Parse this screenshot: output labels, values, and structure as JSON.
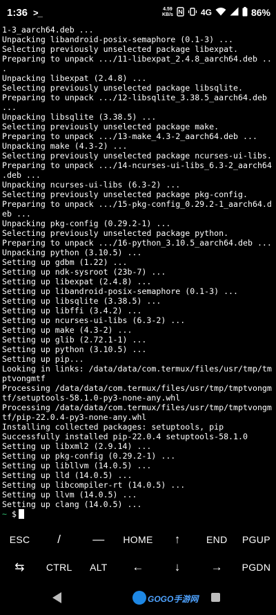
{
  "status_bar": {
    "time": "1:36",
    "app_glyph": ">_",
    "net_speed_value": "4.59",
    "net_speed_unit": "KB/s",
    "network_type": "4G",
    "battery": "86%"
  },
  "terminal": {
    "lines": [
      "1-3_aarch64.deb ...",
      "Unpacking libandroid-posix-semaphore (0.1-3) ...",
      "Selecting previously unselected package libexpat.",
      "Preparing to unpack .../11-libexpat_2.4.8_aarch64.deb ..",
      ".",
      "Unpacking libexpat (2.4.8) ...",
      "Selecting previously unselected package libsqlite.",
      "Preparing to unpack .../12-libsqlite_3.38.5_aarch64.deb",
      "...",
      "Unpacking libsqlite (3.38.5) ...",
      "Selecting previously unselected package make.",
      "Preparing to unpack .../13-make_4.3-2_aarch64.deb ...",
      "Unpacking make (4.3-2) ...",
      "Selecting previously unselected package ncurses-ui-libs.",
      "Preparing to unpack .../14-ncurses-ui-libs_6.3-2_aarch64",
      ".deb ...",
      "Unpacking ncurses-ui-libs (6.3-2) ...",
      "Selecting previously unselected package pkg-config.",
      "Preparing to unpack .../15-pkg-config_0.29.2-1_aarch64.d",
      "eb ...",
      "Unpacking pkg-config (0.29.2-1) ...",
      "Selecting previously unselected package python.",
      "Preparing to unpack .../16-python_3.10.5_aarch64.deb ...",
      "Unpacking python (3.10.5) ...",
      "Setting up gdbm (1.22) ...",
      "Setting up ndk-sysroot (23b-7) ...",
      "Setting up libexpat (2.4.8) ...",
      "Setting up libandroid-posix-semaphore (0.1-3) ...",
      "Setting up libsqlite (3.38.5) ...",
      "Setting up libffi (3.4.2) ...",
      "Setting up ncurses-ui-libs (6.3-2) ...",
      "Setting up make (4.3-2) ...",
      "Setting up glib (2.72.1-1) ...",
      "Setting up python (3.10.5) ...",
      "Setting up pip...",
      "Looking in links: /data/data/com.termux/files/usr/tmp/tm",
      "ptvongmtf",
      "Processing /data/data/com.termux/files/usr/tmp/tmptvongm",
      "tf/setuptools-58.1.0-py3-none-any.whl",
      "Processing /data/data/com.termux/files/usr/tmp/tmptvongm",
      "tf/pip-22.0.4-py3-none-any.whl",
      "Installing collected packages: setuptools, pip",
      "Successfully installed pip-22.0.4 setuptools-58.1.0",
      "Setting up libxml2 (2.9.14) ...",
      "Setting up pkg-config (0.29.2-1) ...",
      "Setting up libllvm (14.0.5) ...",
      "Setting up lld (14.0.5) ...",
      "Setting up libcompiler-rt (14.0.5) ...",
      "Setting up llvm (14.0.5) ...",
      "Setting up clang (14.0.5) ..."
    ],
    "prompt_tilde": "~",
    "prompt_sign": " $"
  },
  "extra_keys": {
    "row1": [
      "ESC",
      "/",
      "—",
      "HOME",
      "↑",
      "END",
      "PGUP"
    ],
    "row2": [
      "⇆",
      "CTRL",
      "ALT",
      "←",
      "↓",
      "→",
      "PGDN"
    ]
  },
  "nav_bar": {
    "watermark": "GOGO手游网"
  },
  "colors": {
    "background": "#000000",
    "text": "#ffffff",
    "prompt": "#2fbf71"
  }
}
